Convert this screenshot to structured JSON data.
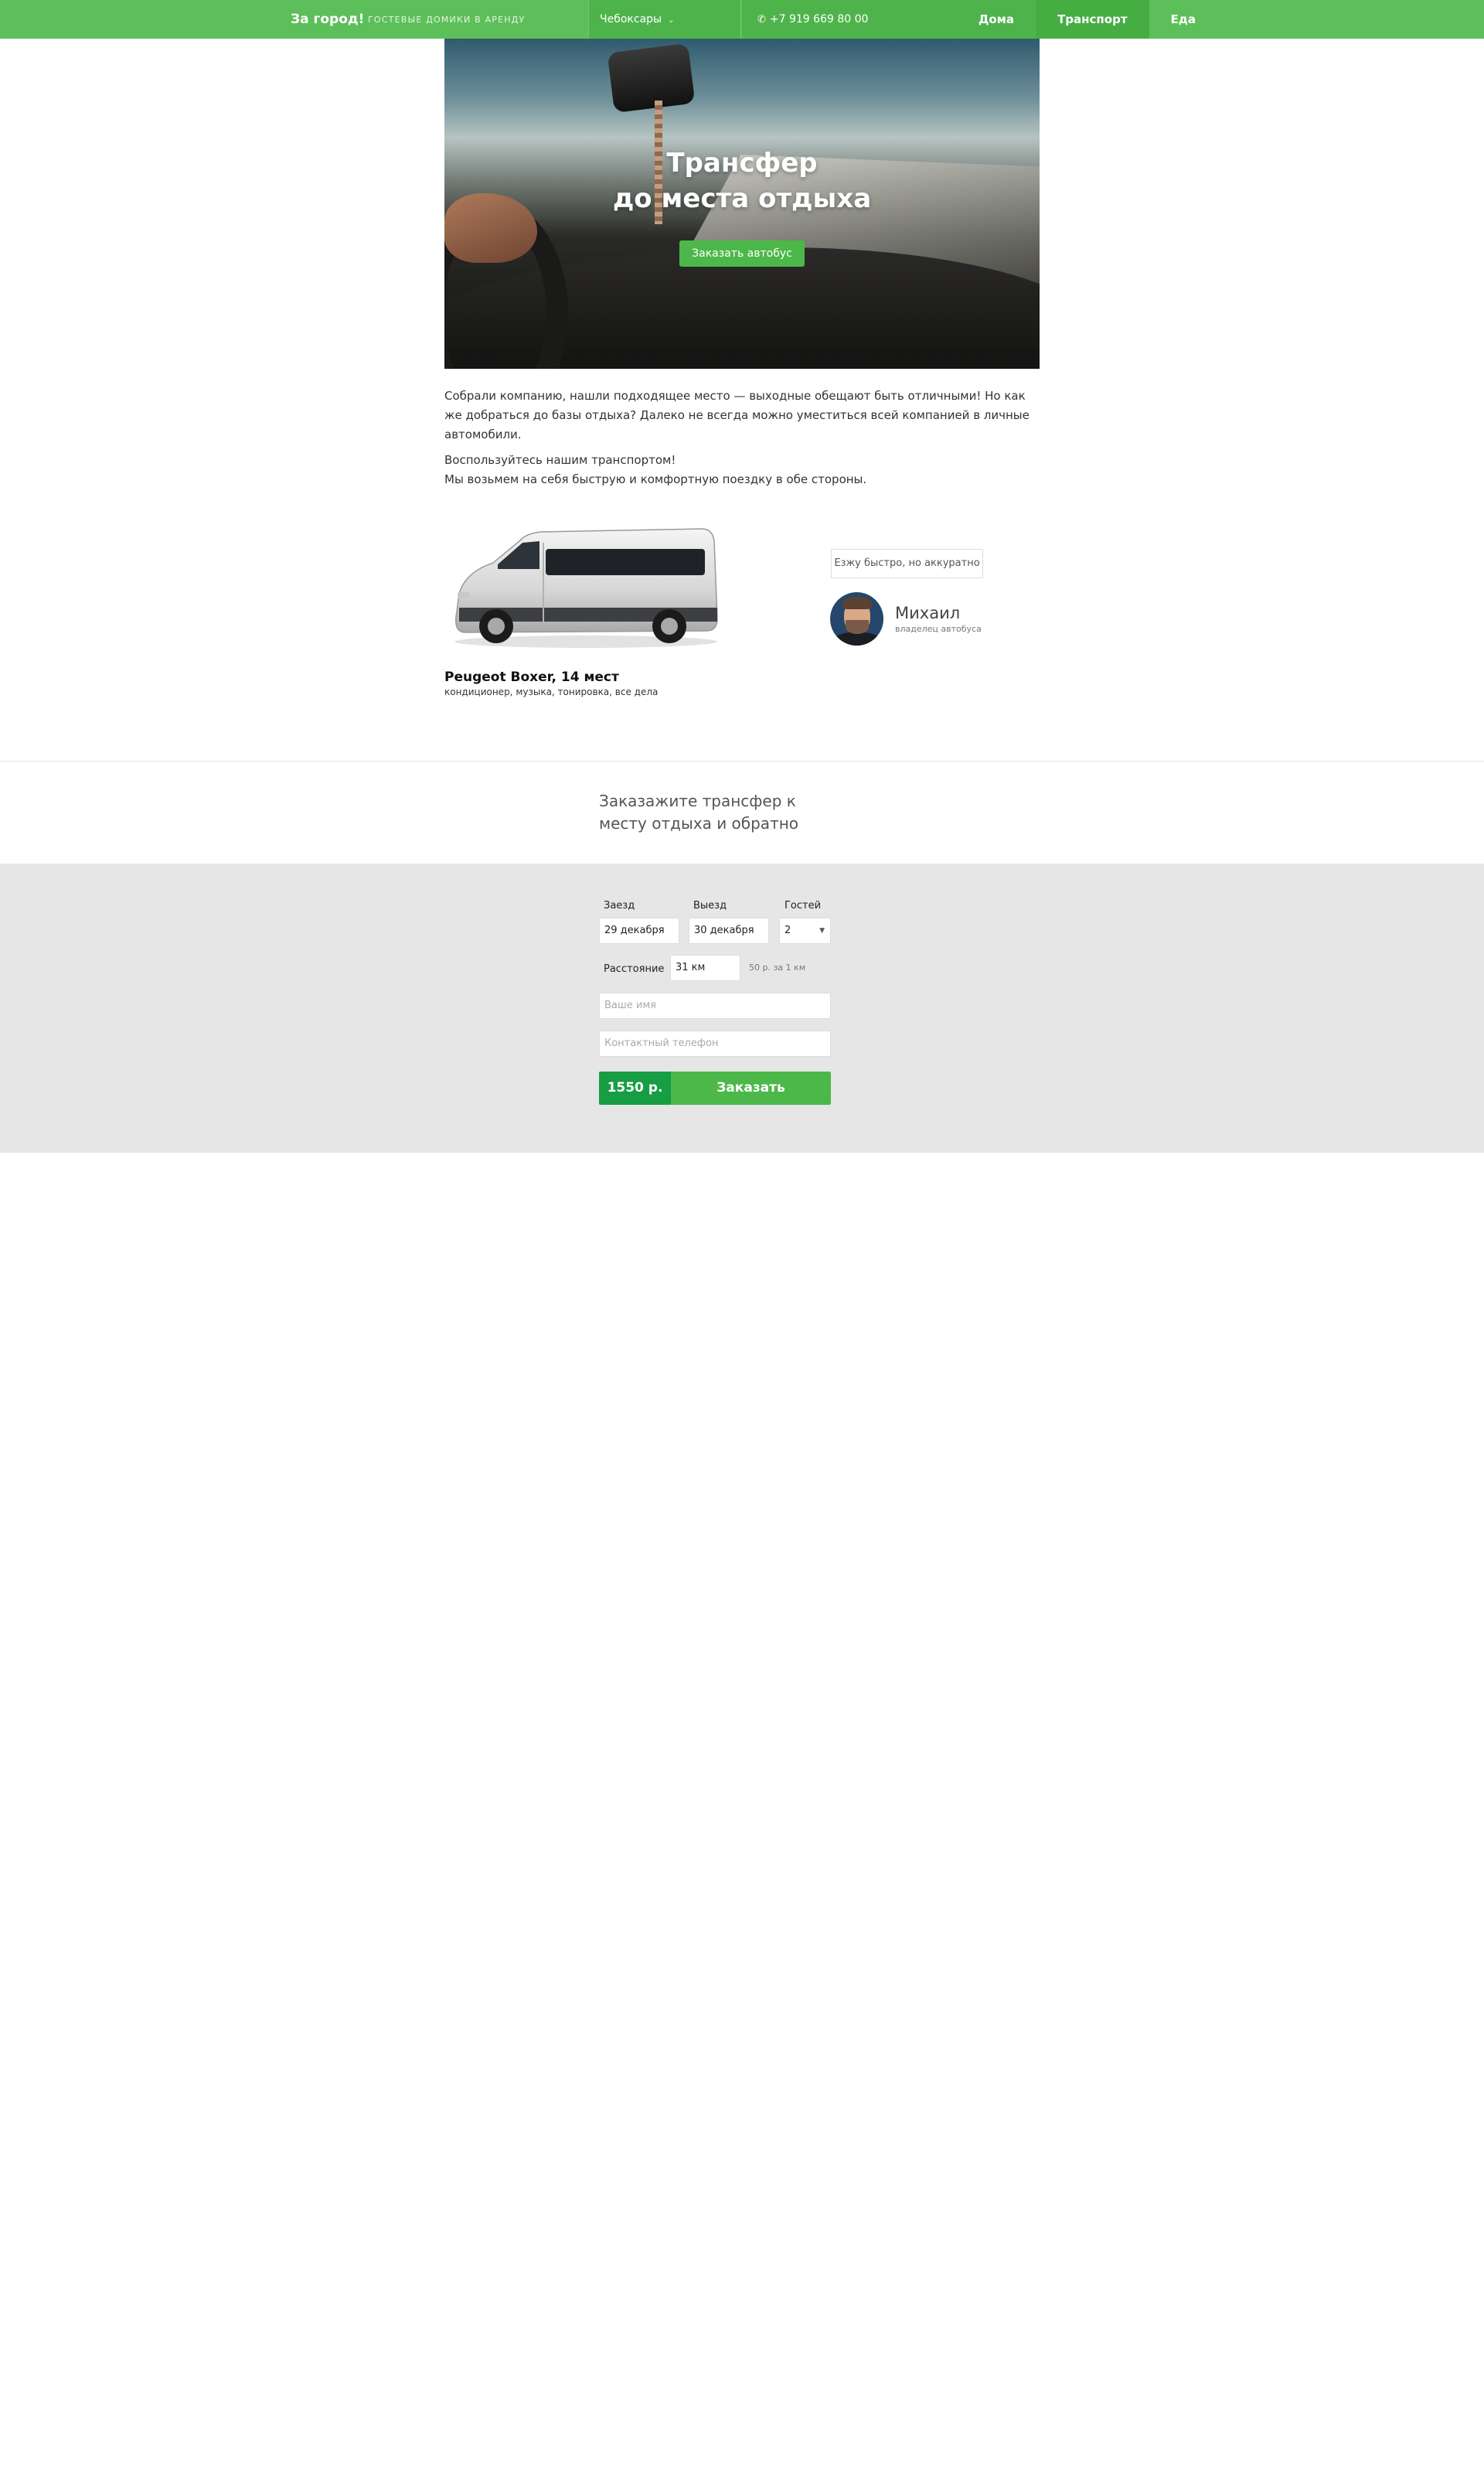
{
  "header": {
    "brand": "За город!",
    "tagline": "гостевые домики в аренду",
    "city": "Чебоксары",
    "phone": "+7 919 669 80 00",
    "nav": [
      {
        "label": "Дома",
        "active": false
      },
      {
        "label": "Транспорт",
        "active": true
      },
      {
        "label": "Еда",
        "active": false
      }
    ]
  },
  "hero": {
    "title_line1": "Трансфер",
    "title_line2": "до места отдыха",
    "button": "Заказать автобус"
  },
  "intro": {
    "p1": "Собрали компанию, нашли подходящее место — выходные обещают быть отличными! Но как же добраться до базы отдыха? Далеко не всегда можно уместиться всей компанией в личные автомобили.",
    "p2_line1": "Воспользуйтесь нашим транспортом!",
    "p2_line2": "Мы возьмем на себя быструю и комфортную поездку в обе стороны."
  },
  "vehicle": {
    "name": "Peugeot Boxer, 14 мест",
    "features": "кондиционер, музыка, тонировка, все дела"
  },
  "owner": {
    "quote": "Езжу быстро, но аккуратно",
    "name": "Михаил",
    "role": "владелец автобуса"
  },
  "order": {
    "title": "Заказажите трансфер к месту отдыха и обратно",
    "checkin_label": "Заезд",
    "checkin_value": "29 декабря",
    "checkout_label": "Выезд",
    "checkout_value": "30 декабря",
    "guests_label": "Гостей",
    "guests_value": "2",
    "distance_label": "Расстояние",
    "distance_value": "31 км",
    "price_note": "50 р. за 1 км",
    "name_placeholder": "Ваше имя",
    "phone_placeholder": "Контактный телефон",
    "price": "1550 р.",
    "submit": "Заказать"
  },
  "colors": {
    "brand_green": "#5dbf5a",
    "button_green": "#4cb849",
    "price_green": "#179d43",
    "form_bg": "#e6e6e6"
  },
  "icons": {
    "phone": "phone-icon",
    "city_dropdown": "chevron-down-icon",
    "guests_dropdown": "triangle-down-icon"
  }
}
